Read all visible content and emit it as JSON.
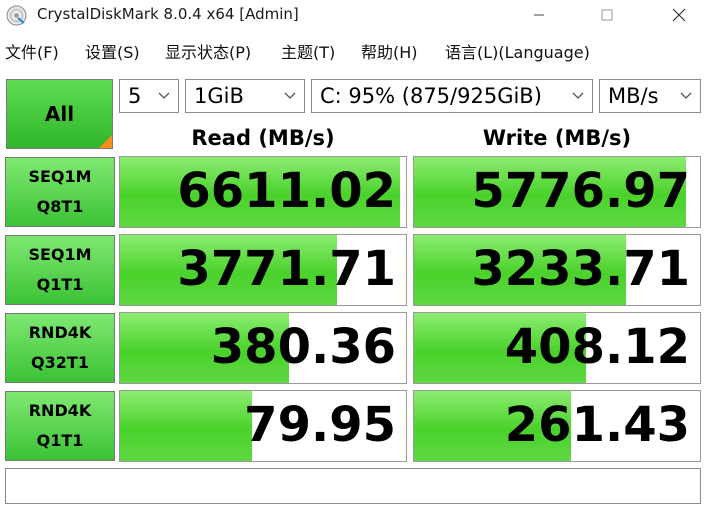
{
  "window": {
    "title": "CrystalDiskMark 8.0.4 x64 [Admin]"
  },
  "menu": [
    "文件(F)",
    "设置(S)",
    "显示状态(P)",
    "主题(T)",
    "帮助(H)",
    "语言(L)(Language)"
  ],
  "controls": {
    "all_label": "All",
    "count": "5",
    "size": "1GiB",
    "drive": "C: 95% (875/925GiB)",
    "unit": "MB/s"
  },
  "headers": {
    "read": "Read (MB/s)",
    "write": "Write (MB/s)"
  },
  "tests": [
    {
      "line1": "SEQ1M",
      "line2": "Q8T1",
      "read": "6611.02",
      "write": "5776.97",
      "read_fill": 0.98,
      "write_fill": 0.95
    },
    {
      "line1": "SEQ1M",
      "line2": "Q1T1",
      "read": "3771.71",
      "write": "3233.71",
      "read_fill": 0.76,
      "write_fill": 0.74
    },
    {
      "line1": "RND4K",
      "line2": "Q32T1",
      "read": "380.36",
      "write": "408.12",
      "read_fill": 0.59,
      "write_fill": 0.6
    },
    {
      "line1": "RND4K",
      "line2": "Q1T1",
      "read": "79.95",
      "write": "261.43",
      "read_fill": 0.46,
      "write_fill": 0.55
    }
  ],
  "comment": "",
  "colors": {
    "bar_green": "#4ad22b",
    "label_green": "#3cc235",
    "accent_orange": "#ff8c1a"
  }
}
